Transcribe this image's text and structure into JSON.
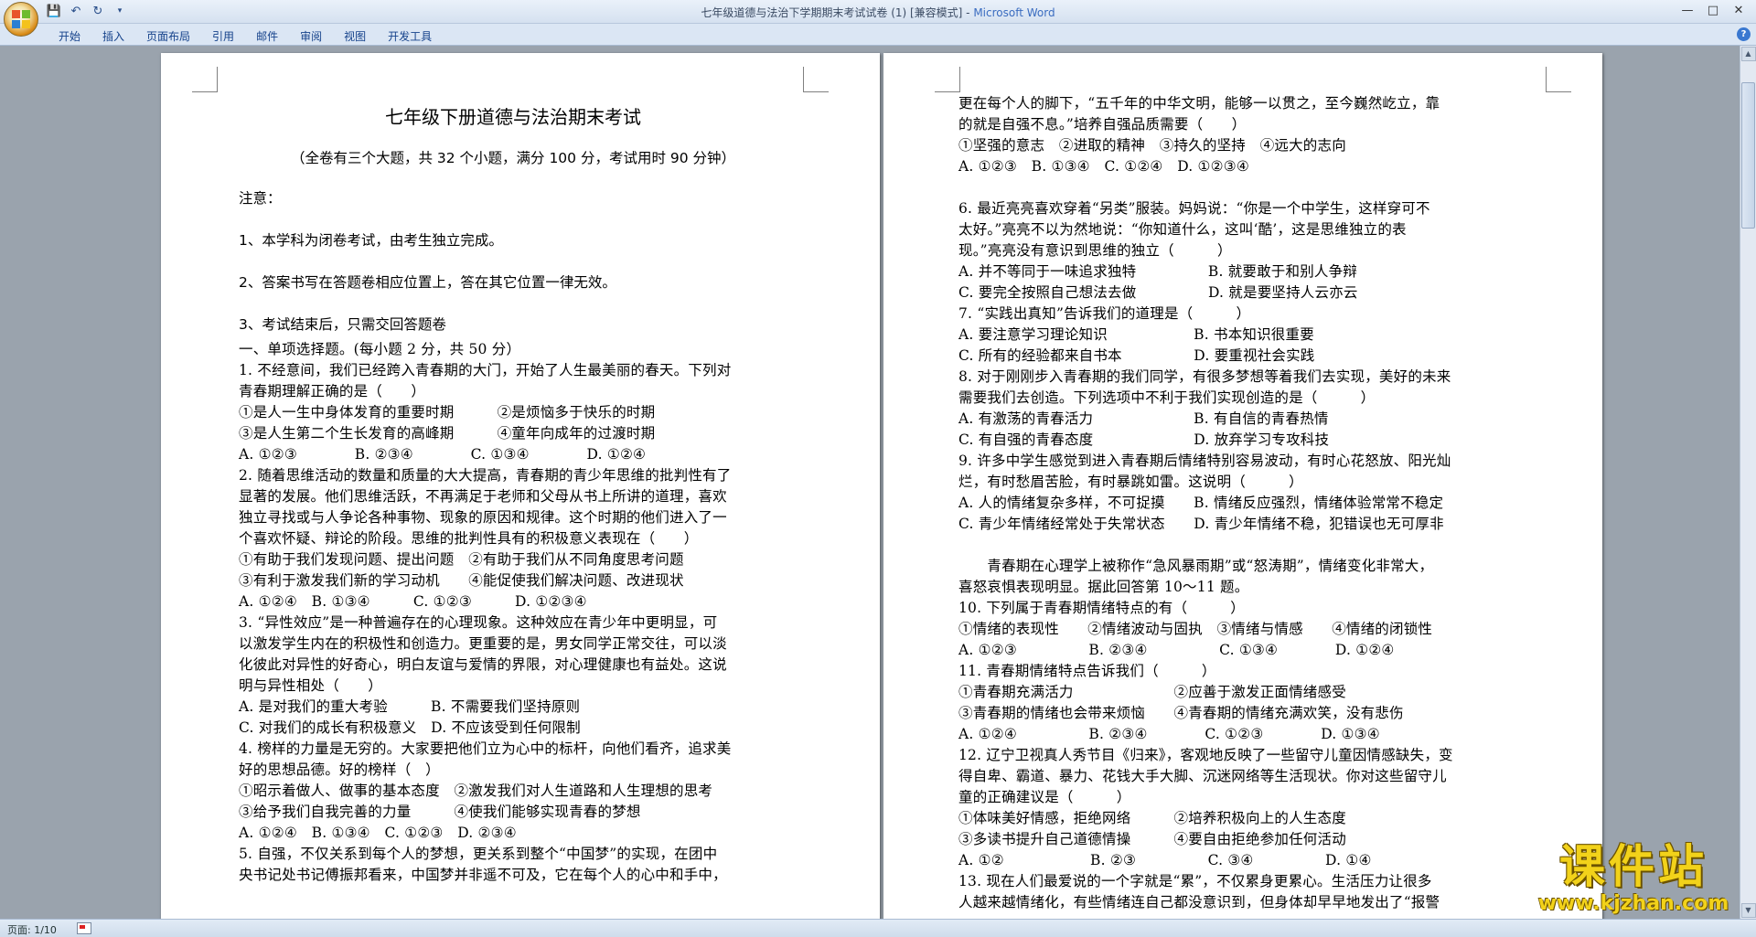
{
  "window": {
    "title_doc": "七年级道德与法治下学期期末考试试卷 (1) [兼容模式] - ",
    "title_app": "Microsoft Word"
  },
  "qat": {
    "save": "save-icon",
    "undo": "undo-icon",
    "redo": "redo-icon",
    "customize": "customize-icon"
  },
  "ribbon": {
    "tabs": [
      "开始",
      "插入",
      "页面布局",
      "引用",
      "邮件",
      "审阅",
      "视图",
      "开发工具"
    ],
    "help": "?"
  },
  "status": {
    "page": "页面: 1/10"
  },
  "watermark": {
    "cn": "课件站",
    "url": "www.kjzhan.com"
  },
  "doc": {
    "left": {
      "title": "七年级下册道德与法治期末考试",
      "subtitle": "（全卷有三个大题，共 32 个小题，满分 100 分，考试用时 90 分钟）",
      "notes": [
        "注意：",
        "1、本学科为闭卷考试，由考生独立完成。",
        "2、答案书写在答题卷相应位置上，答在其它位置一律无效。",
        "3、考试结束后，只需交回答题卷"
      ],
      "lines": [
        "一、单项选择题。(每小题 2 分，共 50 分）",
        "1. 不经意间，我们已经跨入青春期的大门，开始了人生最美丽的春天。下列对",
        "青春期理解正确的是（　　）",
        "①是人一生中身体发育的重要时期　　　②是烦恼多于快乐的时期",
        "③是人生第二个生长发育的高峰期　　　④童年向成年的过渡时期",
        "A. ①②③　　　　B. ②③④　　　　C. ①③④　　　　D. ①②④",
        "2. 随着思维活动的数量和质量的大大提高，青春期的青少年思维的批判性有了",
        "显著的发展。他们思维活跃，不再满足于老师和父母从书上所讲的道理，喜欢",
        "独立寻找或与人争论各种事物、现象的原因和规律。这个时期的他们进入了一",
        "个喜欢怀疑、辩论的阶段。思维的批判性具有的积极意义表现在（　　）",
        "①有助于我们发现问题、提出问题　②有助于我们从不同角度思考问题",
        "③有利于激发我们新的学习动机　　④能促使我们解决问题、改进现状",
        "A. ①②④　B. ①③④　　　C. ①②③　　　D. ①②③④",
        "3. “异性效应”是一种普遍存在的心理现象。这种效应在青少年中更明显，可",
        "以激发学生内在的积极性和创造力。更重要的是，男女同学正常交往，可以淡",
        "化彼此对异性的好奇心，明白友谊与爱情的界限，对心理健康也有益处。这说",
        "明与异性相处（　　）",
        "A. 是对我们的重大考验　　　B. 不需要我们坚持原则",
        "C. 对我们的成长有积极意义　D. 不应该受到任何限制",
        "4. 榜样的力量是无穷的。大家要把他们立为心中的标杆，向他们看齐，追求美",
        "好的思想品德。好的榜样（　）",
        "①昭示着做人、做事的基本态度　②激发我们对人生道路和人生理想的思考",
        "③给予我们自我完善的力量　　　④使我们能够实现青春的梦想",
        "A. ①②④　B. ①③④　C. ①②③　D. ②③④",
        "5. 自强，不仅关系到每个人的梦想，更关系到整个“中国梦”的实现，在团中",
        "央书记处书记傅振邦看来，中国梦并非遥不可及，它在每个人的心中和手中，"
      ]
    },
    "right": {
      "lines": [
        "更在每个人的脚下，“五千年的中华文明，能够一以贯之，至今巍然屹立，靠",
        "的就是自强不息。”培养自强品质需要（　　）",
        "①坚强的意志　②进取的精神　③持久的坚持　④远大的志向",
        "A. ①②③　B. ①③④　C. ①②④　D. ①②③④",
        "",
        "6. 最近亮亮喜欢穿着“另类”服装。妈妈说：“你是一个中学生，这样穿可不",
        "太好。”亮亮不以为然地说：“你知道什么，这叫‘酷’，这是思维独立的表",
        "现。”亮亮没有意识到思维的独立（　　　）",
        "A. 并不等同于一味追求独特　　　　　B. 就要敢于和别人争辩",
        "C. 要完全按照自己想法去做　　　　　D. 就是要坚持人云亦云",
        "7. “实践出真知”告诉我们的道理是（　　　）",
        "A. 要注意学习理论知识　　　　　　B. 书本知识很重要",
        "C. 所有的经验都来自书本　　　　　D. 要重视社会实践",
        "8. 对于刚刚步入青春期的我们同学，有很多梦想等着我们去实现，美好的未来",
        "需要我们去创造。下列选项中不利于我们实现创造的是（　　　）",
        "A. 有激荡的青春活力　　　　　　　B. 有自信的青春热情",
        "C. 有自强的青春态度　　　　　　　D. 放弃学习专攻科技",
        "9. 许多中学生感觉到进入青春期后情绪特别容易波动，有时心花怒放、阳光灿",
        "烂，有时愁眉苦脸，有时暴跳如雷。这说明（　　　）",
        "A. 人的情绪复杂多样，不可捉摸　　B. 情绪反应强烈，情绪体验常常不稳定",
        "C. 青少年情绪经常处于失常状态　　D. 青少年情绪不稳，犯错误也无可厚非",
        "",
        "　　青春期在心理学上被称作“急风暴雨期”或“怒涛期”，情绪变化非常大，",
        "喜怒哀惧表现明显。据此回答第 10～11 题。",
        "10. 下列属于青春期情绪特点的有（　　　）",
        "①情绪的表现性　　②情绪波动与固执　③情绪与情感　　④情绪的闭锁性",
        "A. ①②③　　　　　B. ②③④　　　　　C. ①③④　　　　D. ①②④",
        "11. 青春期情绪特点告诉我们（　　　）",
        "①青春期充满活力　　　　　　　②应善于激发正面情绪感受",
        "③青春期的情绪也会带来烦恼　　④青春期的情绪充满欢笑，没有悲伤",
        "A. ①②④　　　　　B. ②③④　　　　C. ①②③　　　　D. ①③④",
        "12. 辽宁卫视真人秀节目《归来》，客观地反映了一些留守儿童因情感缺失，变",
        "得自卑、霸道、暴力、花钱大手大脚、沉迷网络等生活现状。你对这些留守儿",
        "童的正确建议是（　　　）",
        "①体味美好情感，拒绝网络　　　②培养积极向上的人生态度",
        "③多读书提升自己道德情操　　　④要自由拒绝参加任何活动",
        "A. ①②　　　　　　B. ②③　　　　　C. ③④　　　　　D. ①④",
        "13. 现在人们最爱说的一个字就是“累”，不仅累身更累心。生活压力让很多",
        "人越来越情绪化，有些情绪连自己都没意识到，但身体却早早地发出了“报警"
      ]
    }
  }
}
